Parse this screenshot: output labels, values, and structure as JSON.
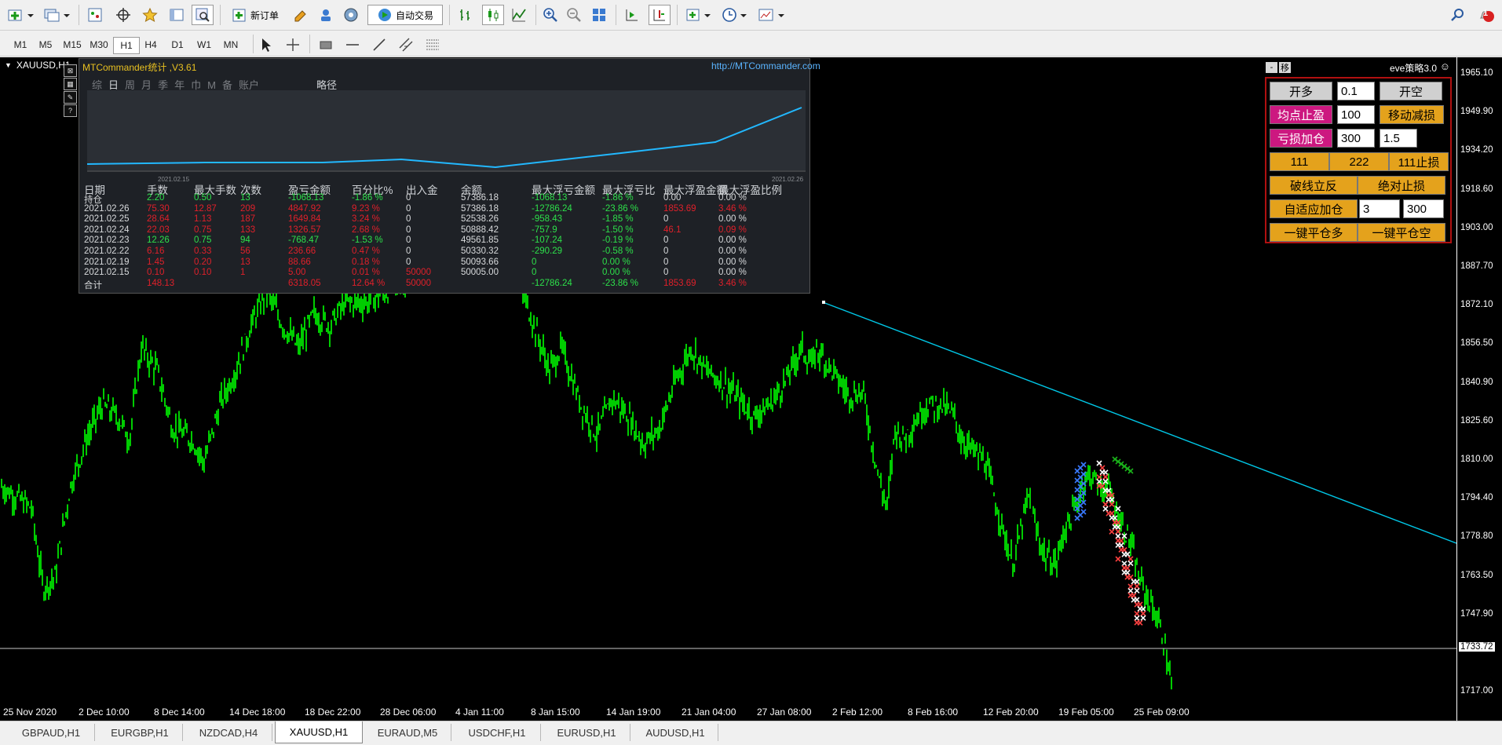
{
  "toolbar": {
    "new_order_label": "新订单",
    "auto_trade_label": "自动交易",
    "notification_count": "1"
  },
  "timeframes": [
    "M1",
    "M5",
    "M15",
    "M30",
    "H1",
    "H4",
    "D1",
    "W1",
    "MN"
  ],
  "active_timeframe": "H1",
  "chart": {
    "symbol_label": "XAUUSD,H1",
    "current_price": "1733.72",
    "y_labels": [
      "1965.10",
      "1949.90",
      "1934.20",
      "1918.60",
      "1903.00",
      "1887.70",
      "1872.10",
      "1856.50",
      "1840.90",
      "1825.60",
      "1810.00",
      "1794.40",
      "1778.80",
      "1763.50",
      "1747.90",
      "1733.72",
      "1717.00"
    ],
    "x_labels": [
      "25 Nov 2020",
      "2 Dec 10:00",
      "8 Dec 14:00",
      "14 Dec 18:00",
      "18 Dec 22:00",
      "28 Dec 06:00",
      "4 Jan 11:00",
      "8 Jan 15:00",
      "14 Jan 19:00",
      "21 Jan 04:00",
      "27 Jan 08:00",
      "2 Feb 12:00",
      "8 Feb 16:00",
      "12 Feb 20:00",
      "19 Feb 05:00",
      "25 Feb 09:00"
    ],
    "colors": {
      "candles": "#00ff00",
      "trendline": "#00c8e8",
      "background": "#000000"
    }
  },
  "mtc": {
    "title": "MTCommander统计 ,V3.61",
    "url": "http://MTCommander.com",
    "tabs": [
      "综",
      "日",
      "周",
      "月",
      "季",
      "年",
      "巾",
      "M",
      "备",
      "账户"
    ],
    "selected_tab": "日",
    "lucky_label": "略径",
    "equity_start_date": "2021.02.15",
    "equity_end_date": "2021.02.26",
    "headers": [
      "日期",
      "手数",
      "最大手数",
      "次数",
      "盈亏金额",
      "百分比%",
      "出入金",
      "余额",
      "最大浮亏金额",
      "最大浮亏比",
      "最大浮盈金额",
      "最大浮盈比例"
    ],
    "rows": [
      {
        "date": "持仓",
        "lots": "2.20",
        "max_lots": "0.50",
        "count": "13",
        "pnl": "-1068.13",
        "pct": "-1.86 %",
        "cash": "0",
        "balance": "57386.18",
        "max_float_loss": "-1068.13",
        "max_float_loss_pct": "-1.86 %",
        "max_float_profit": "0.00",
        "max_float_profit_pct": "0.00 %",
        "tone": "g"
      },
      {
        "date": "2021.02.26",
        "lots": "75.30",
        "max_lots": "12.87",
        "count": "209",
        "pnl": "4847.92",
        "pct": "9.23 %",
        "cash": "0",
        "balance": "57386.18",
        "max_float_loss": "-12786.24",
        "max_float_loss_pct": "-23.86 %",
        "max_float_profit": "1853.69",
        "max_float_profit_pct": "3.46 %",
        "tone": "r"
      },
      {
        "date": "2021.02.25",
        "lots": "28.64",
        "max_lots": "1.13",
        "count": "187",
        "pnl": "1649.84",
        "pct": "3.24 %",
        "cash": "0",
        "balance": "52538.26",
        "max_float_loss": "-958.43",
        "max_float_loss_pct": "-1.85 %",
        "max_float_profit": "0",
        "max_float_profit_pct": "0.00 %",
        "tone": "r"
      },
      {
        "date": "2021.02.24",
        "lots": "22.03",
        "max_lots": "0.75",
        "count": "133",
        "pnl": "1326.57",
        "pct": "2.68 %",
        "cash": "0",
        "balance": "50888.42",
        "max_float_loss": "-757.9",
        "max_float_loss_pct": "-1.50 %",
        "max_float_profit": "46.1",
        "max_float_profit_pct": "0.09 %",
        "tone": "r"
      },
      {
        "date": "2021.02.23",
        "lots": "12.26",
        "max_lots": "0.75",
        "count": "94",
        "pnl": "-768.47",
        "pct": "-1.53 %",
        "cash": "0",
        "balance": "49561.85",
        "max_float_loss": "-107.24",
        "max_float_loss_pct": "-0.19 %",
        "max_float_profit": "0",
        "max_float_profit_pct": "0.00 %",
        "tone": "g"
      },
      {
        "date": "2021.02.22",
        "lots": "6.16",
        "max_lots": "0.33",
        "count": "56",
        "pnl": "236.66",
        "pct": "0.47 %",
        "cash": "0",
        "balance": "50330.32",
        "max_float_loss": "-290.29",
        "max_float_loss_pct": "-0.58 %",
        "max_float_profit": "0",
        "max_float_profit_pct": "0.00 %",
        "tone": "r"
      },
      {
        "date": "2021.02.19",
        "lots": "1.45",
        "max_lots": "0.20",
        "count": "13",
        "pnl": "88.66",
        "pct": "0.18 %",
        "cash": "0",
        "balance": "50093.66",
        "max_float_loss": "0",
        "max_float_loss_pct": "0.00 %",
        "max_float_profit": "0",
        "max_float_profit_pct": "0.00 %",
        "tone": "r"
      },
      {
        "date": "2021.02.15",
        "lots": "0.10",
        "max_lots": "0.10",
        "count": "1",
        "pnl": "5.00",
        "pct": "0.01 %",
        "cash": "50000",
        "balance": "50005.00",
        "max_float_loss": "0",
        "max_float_loss_pct": "0.00 %",
        "max_float_profit": "0",
        "max_float_profit_pct": "0.00 %",
        "tone": "r"
      },
      {
        "date": "合计",
        "lots": "148.13",
        "max_lots": "",
        "count": "",
        "pnl": "6318.05",
        "pct": "12.64 %",
        "cash": "50000",
        "balance": "",
        "max_float_loss": "-12786.24",
        "max_float_loss_pct": "-23.86 %",
        "max_float_profit": "1853.69",
        "max_float_profit_pct": "3.46 %",
        "tone": "r"
      }
    ]
  },
  "eve": {
    "minimize_label": "-",
    "move_label": "移",
    "title": "eve策略3.0",
    "buy_label": "开多",
    "lot_value": "0.1",
    "sell_label": "开空",
    "avg_tp_label": "均点止盈",
    "avg_tp_value": "100",
    "trail_label": "移动减损",
    "loss_add_label": "亏损加仓",
    "loss_add_value": "300",
    "loss_add_mult": "1.5",
    "btn_111": "111",
    "btn_222": "222",
    "btn_111_stop": "111止损",
    "break_reverse_label": "破线立反",
    "absolute_stop_label": "绝对止损",
    "adaptive_add_label": "自适应加仓",
    "adaptive_add_value1": "3",
    "adaptive_add_value2": "300",
    "close_all_long_label": "一键平仓多",
    "close_all_short_label": "一键平仓空"
  },
  "tabs": [
    "GBPAUD,H1",
    "EURGBP,H1",
    "NZDCAD,H4",
    "XAUUSD,H1",
    "EURAUD,M5",
    "USDCHF,H1",
    "EURUSD,H1",
    "AUDUSD,H1"
  ],
  "active_tab": "XAUUSD,H1"
}
